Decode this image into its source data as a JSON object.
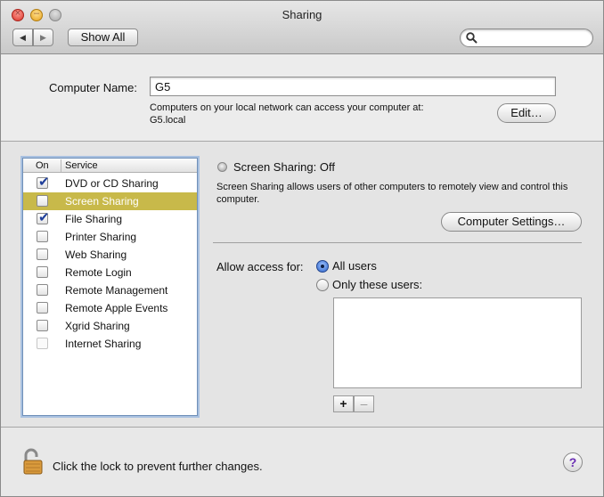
{
  "window": {
    "title": "Sharing",
    "traffic_lights": {
      "close_glyph": "×",
      "min_glyph": "–"
    }
  },
  "toolbar": {
    "back_glyph": "◀",
    "forward_glyph": "▶",
    "show_all": "Show All",
    "search_placeholder": "",
    "search_icon": "magnifier-icon"
  },
  "computer_name": {
    "label": "Computer Name:",
    "value": "G5",
    "hint_line1": "Computers on your local network can access your computer at:",
    "hint_line2": "G5.local",
    "edit_button": "Edit…"
  },
  "services": {
    "header_on": "On",
    "header_service": "Service",
    "items": [
      {
        "label": "DVD or CD Sharing",
        "checked": true,
        "selected": false,
        "enabled": true
      },
      {
        "label": "Screen Sharing",
        "checked": false,
        "selected": true,
        "enabled": true
      },
      {
        "label": "File Sharing",
        "checked": true,
        "selected": false,
        "enabled": true
      },
      {
        "label": "Printer Sharing",
        "checked": false,
        "selected": false,
        "enabled": true
      },
      {
        "label": "Web Sharing",
        "checked": false,
        "selected": false,
        "enabled": true
      },
      {
        "label": "Remote Login",
        "checked": false,
        "selected": false,
        "enabled": true
      },
      {
        "label": "Remote Management",
        "checked": false,
        "selected": false,
        "enabled": true
      },
      {
        "label": "Remote Apple Events",
        "checked": false,
        "selected": false,
        "enabled": true
      },
      {
        "label": "Xgrid Sharing",
        "checked": false,
        "selected": false,
        "enabled": true
      },
      {
        "label": "Internet Sharing",
        "checked": false,
        "selected": false,
        "enabled": false
      }
    ],
    "check_glyph": "✔"
  },
  "detail": {
    "status": "Screen Sharing: Off",
    "description": "Screen Sharing allows users of other computers to remotely view and control this computer.",
    "computer_settings_button": "Computer Settings…",
    "access_label": "Allow access for:",
    "option_all_users": "All users",
    "option_only_these": "Only these users:",
    "selected_option": "all_users",
    "add_glyph": "+",
    "remove_glyph": "–"
  },
  "footer": {
    "lock_text": "Click the lock to prevent further changes.",
    "help_glyph": "?"
  }
}
